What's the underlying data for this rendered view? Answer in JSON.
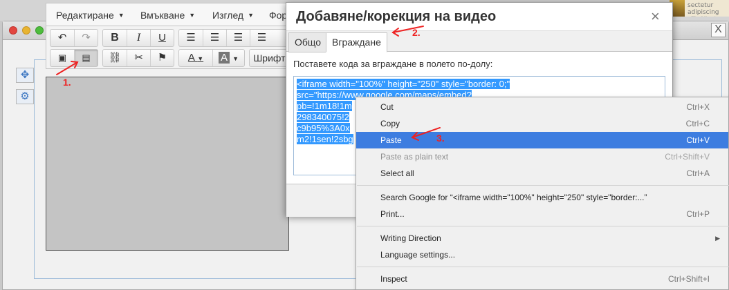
{
  "background": {
    "snippet": "sectetur adipiscing elit. Ut ut"
  },
  "editor": {
    "menu": [
      {
        "label": "Редактиране"
      },
      {
        "label": "Вмъкване"
      },
      {
        "label": "Изглед"
      },
      {
        "label": "Фор"
      }
    ],
    "toolbar": {
      "font_button": "Шрифт",
      "icons": [
        "undo-icon",
        "redo-icon",
        "bold-icon",
        "italic-icon",
        "underline-icon",
        "align-left-icon",
        "align-center-icon",
        "align-right-icon",
        "align-justify-icon",
        "image-icon",
        "video-icon",
        "link-icon",
        "unlink-icon",
        "bookmark-icon",
        "text-color-icon",
        "background-color-icon"
      ],
      "bold": "B",
      "italic": "I",
      "underline": "U",
      "text_color": "A",
      "background_color": "A"
    }
  },
  "dialog": {
    "title": "Добавяне/корекция на видео",
    "close": "×",
    "tabs": [
      {
        "label": "Общо"
      },
      {
        "label": "Вграждане"
      }
    ],
    "active_tab": "Вграждане",
    "instructions": "Поставете кода за вграждане в полето по-долу:",
    "embed_lines": [
      "<iframe width=\"100%\" height=\"250\" style=\"border: 0;\"",
      "src=\"https://www.google.com/maps/embed?",
      "pb=!1m18!1m",
      "298340075!2",
      "c9b95%3A0x",
      "m2!1sen!2sbg"
    ]
  },
  "context_menu": {
    "items": [
      {
        "label": "Cut",
        "shortcut": "Ctrl+X",
        "disabled": false
      },
      {
        "label": "Copy",
        "shortcut": "Ctrl+C",
        "disabled": false
      },
      {
        "label": "Paste",
        "shortcut": "Ctrl+V",
        "disabled": false,
        "highlighted": true
      },
      {
        "label": "Paste as plain text",
        "shortcut": "Ctrl+Shift+V",
        "disabled": true
      },
      {
        "label": "Select all",
        "shortcut": "Ctrl+A",
        "disabled": false
      },
      {
        "label": "Search Google for “<iframe width=\"100%\" height=\"250\" style=\"border:...”",
        "shortcut": "",
        "disabled": false
      },
      {
        "label": "Print...",
        "shortcut": "Ctrl+P",
        "disabled": false
      },
      {
        "label": "Writing Direction",
        "shortcut": "",
        "disabled": false,
        "submenu": true
      },
      {
        "label": "Language settings...",
        "shortcut": "",
        "disabled": false
      },
      {
        "label": "Inspect",
        "shortcut": "Ctrl+Shift+I",
        "disabled": false
      }
    ]
  },
  "outer_window": {
    "close": "X"
  },
  "annotations": {
    "step1": "1.",
    "step2": "2.",
    "step3": "3."
  },
  "colors": {
    "highlight": "#3d7de0",
    "selection": "#3399ff",
    "annotation": "#e22222"
  }
}
